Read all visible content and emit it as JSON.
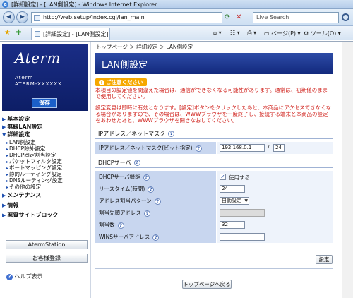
{
  "window": {
    "title": "[詳細設定] - [LAN側設定] - Windows Internet Explorer"
  },
  "addressbar": {
    "url": "http://web.setup/index.cgi/lan_main",
    "search_placeholder": "Live Search"
  },
  "tabs": [
    {
      "label": "[詳細設定] - [LAN側設定]"
    }
  ],
  "toolbar": {
    "page_label": "ページ(P)",
    "tools_label": "ツール(O)"
  },
  "sidebar": {
    "brand": "Aterm",
    "brand_line1": "Aterm",
    "brand_line2": "ATERM-XXXXXX",
    "save_label": "保存",
    "sections": [
      {
        "label": "基本設定",
        "items": []
      },
      {
        "label": "無線LAN設定",
        "items": []
      },
      {
        "label": "詳細設定",
        "items": [
          "LAN側設定",
          "DHCP除外設定",
          "DHCP固定割当設定",
          "パケットフィルタ設定",
          "ポートマッピング設定",
          "静的ルーティング設定",
          "DNSルーティング設定",
          "その他の設定"
        ]
      },
      {
        "label": "メンテナンス",
        "items": []
      },
      {
        "label": "情報",
        "items": []
      },
      {
        "label": "悪質サイトブロック",
        "items": []
      }
    ],
    "aterm_station_label": "AtermStation",
    "customer_reg_label": "お客様登録",
    "help_label": "ヘルプ表示"
  },
  "main": {
    "breadcrumb": "トップページ ＞ 詳細設定 ＞ LAN側設定",
    "page_title": "LAN側設定",
    "notice_badge": "ご注意ください",
    "notice_text1": "本項目の設定値を間違えた場合は、通信ができなくなる可能性があります。通常は、初期値のままで使用してください。",
    "notice_text2": "設定変更は即時に有効となります。[設定]ボタンをクリックしたあと、本商品にアクセスできなくなる場合がありますので、その場合は、WWWブラウザを一度終了し、接続する端末と本商品の設定をあわせたあと、WWWブラウザを開きなおしてください。",
    "ip_group": {
      "title": "IPアドレス／ネットマスク",
      "row_label": "IPアドレス／ネットマスク(ビット指定)",
      "ip_value": "192.168.0.1",
      "mask_value": "24",
      "separator": "/"
    },
    "dhcp_group": {
      "title": "DHCPサーバ",
      "rows": [
        {
          "label": "DHCPサーバ機能",
          "value": "使用する"
        },
        {
          "label": "リースタイム(時間)",
          "value": "24"
        },
        {
          "label": "アドレス割当パターン",
          "value": "自動設定"
        },
        {
          "label": "割当先頭アドレス",
          "value": ""
        },
        {
          "label": "割当数",
          "value": "32"
        },
        {
          "label": "WINSサーバアドレス",
          "value": ""
        }
      ]
    },
    "submit_label": "設定",
    "top_label": "トップページへ戻る"
  }
}
